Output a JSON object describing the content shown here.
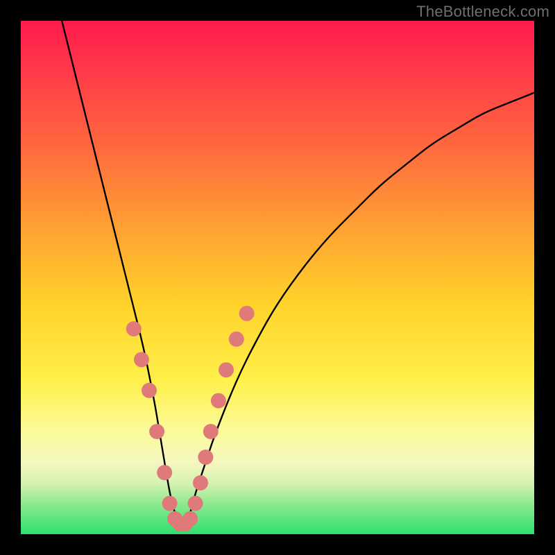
{
  "watermark": "TheBottleneck.com",
  "chart_data": {
    "type": "line",
    "title": "",
    "xlabel": "",
    "ylabel": "",
    "xlim": [
      0,
      100
    ],
    "ylim": [
      0,
      100
    ],
    "grid": false,
    "legend": false,
    "series": [
      {
        "name": "bottleneck-curve",
        "x": [
          8,
          10,
          12,
          14,
          16,
          18,
          20,
          22,
          24,
          26,
          27,
          28,
          29,
          30,
          31,
          32,
          33,
          34,
          36,
          38,
          42,
          46,
          50,
          55,
          60,
          65,
          70,
          75,
          80,
          85,
          90,
          95,
          100
        ],
        "y": [
          100,
          92,
          84,
          76,
          68,
          60,
          52,
          44,
          36,
          26,
          20,
          14,
          8,
          4,
          2,
          2,
          4,
          8,
          14,
          20,
          30,
          38,
          45,
          52,
          58,
          63,
          68,
          72,
          76,
          79,
          82,
          84,
          86
        ]
      }
    ],
    "markers": {
      "name": "highlight-dots",
      "color": "#e07a7a",
      "points": [
        {
          "x": 22,
          "y": 40
        },
        {
          "x": 23.5,
          "y": 34
        },
        {
          "x": 25,
          "y": 28
        },
        {
          "x": 26.5,
          "y": 20
        },
        {
          "x": 28,
          "y": 12
        },
        {
          "x": 29,
          "y": 6
        },
        {
          "x": 30,
          "y": 3
        },
        {
          "x": 31,
          "y": 2
        },
        {
          "x": 32,
          "y": 2
        },
        {
          "x": 33,
          "y": 3
        },
        {
          "x": 34,
          "y": 6
        },
        {
          "x": 35,
          "y": 10
        },
        {
          "x": 36,
          "y": 15
        },
        {
          "x": 37,
          "y": 20
        },
        {
          "x": 38.5,
          "y": 26
        },
        {
          "x": 40,
          "y": 32
        },
        {
          "x": 42,
          "y": 38
        },
        {
          "x": 44,
          "y": 43
        }
      ]
    },
    "gradient_stops": [
      {
        "pos": 0,
        "color": "#ff1a4d"
      },
      {
        "pos": 25,
        "color": "#ff6a3e"
      },
      {
        "pos": 55,
        "color": "#ffd22a"
      },
      {
        "pos": 80,
        "color": "#fcfb9a"
      },
      {
        "pos": 100,
        "color": "#2fe06f"
      }
    ]
  }
}
